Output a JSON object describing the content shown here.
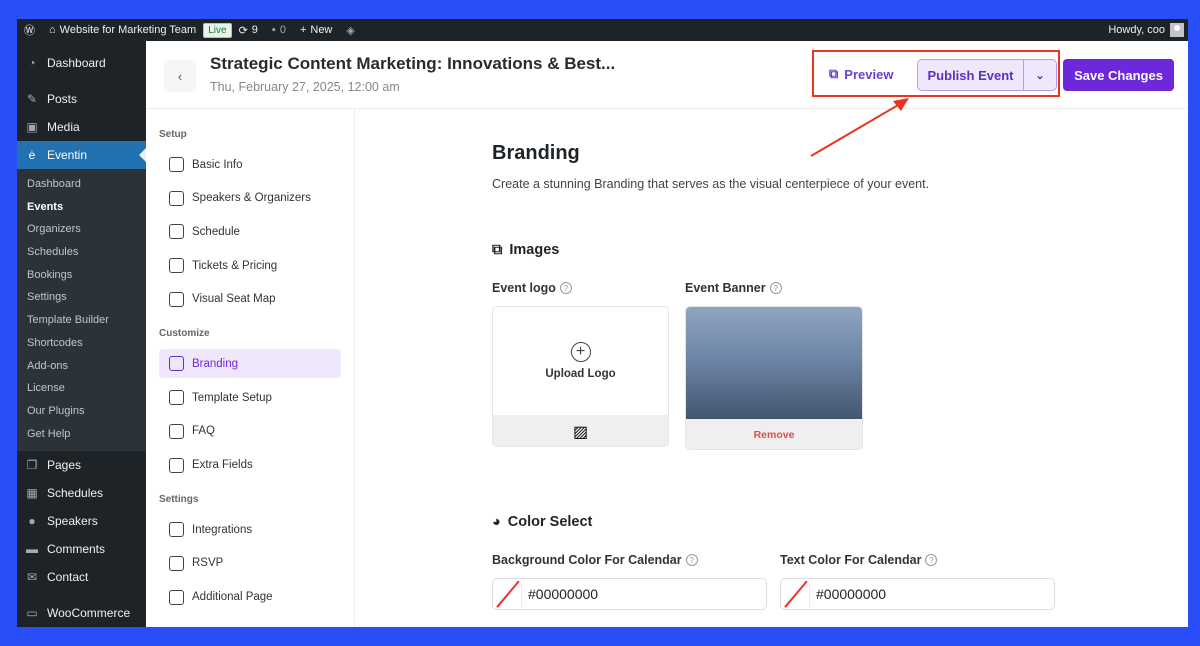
{
  "adminbar": {
    "site": "Website for Marketing Team",
    "live": "Live",
    "updates": "9",
    "comments": "0",
    "new": "New",
    "howdy": "Howdy, coo"
  },
  "wpmenu": {
    "top": [
      {
        "label": "Dashboard",
        "icon": "dashboard-icon"
      },
      {
        "label": "Posts",
        "icon": "pin-icon"
      },
      {
        "label": "Media",
        "icon": "media-icon"
      }
    ],
    "active": "Eventin",
    "sub": [
      "Dashboard",
      "Events",
      "Organizers",
      "Schedules",
      "Bookings",
      "Settings",
      "Template Builder",
      "Shortcodes",
      "Add-ons",
      "License",
      "Our Plugins",
      "Get Help"
    ],
    "current_sub": "Events",
    "bottom": [
      {
        "label": "Pages"
      },
      {
        "label": "Schedules"
      },
      {
        "label": "Speakers"
      },
      {
        "label": "Comments"
      },
      {
        "label": "Contact"
      },
      {
        "label": "WooCommerce"
      }
    ]
  },
  "header": {
    "title": "Strategic Content Marketing: Innovations & Best...",
    "date": "Thu, February 27, 2025, 12:00 am",
    "preview": "Preview",
    "publish": "Publish Event",
    "save": "Save Changes"
  },
  "nav": {
    "sections": [
      {
        "title": "Setup",
        "items": [
          "Basic Info",
          "Speakers & Organizers",
          "Schedule",
          "Tickets & Pricing",
          "Visual Seat Map"
        ]
      },
      {
        "title": "Customize",
        "items": [
          "Branding",
          "Template Setup",
          "FAQ",
          "Extra Fields"
        ]
      },
      {
        "title": "Settings",
        "items": [
          "Integrations",
          "RSVP",
          "Additional Page"
        ]
      }
    ],
    "active": "Branding"
  },
  "main": {
    "title": "Branding",
    "description": "Create a stunning Branding that serves as the visual centerpiece of your event.",
    "images_heading": "Images",
    "logo_label": "Event logo",
    "banner_label": "Event Banner",
    "upload_logo": "Upload Logo",
    "remove": "Remove",
    "color_heading": "Color Select",
    "bg_color_label": "Background Color For Calendar",
    "text_color_label": "Text Color For Calendar",
    "bg_color_value": "#00000000",
    "text_color_value": "#00000000"
  },
  "colors": {
    "accent": "#6d28d9",
    "highlight": "#e8351f"
  }
}
